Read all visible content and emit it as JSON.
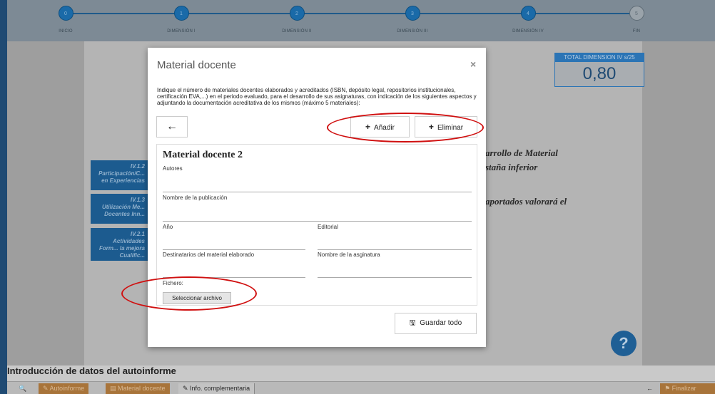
{
  "stepper": {
    "steps": [
      {
        "label": "INICIO",
        "num": "0"
      },
      {
        "label": "DIMENSIÓN I",
        "num": "1"
      },
      {
        "label": "DIMENSIÓN II",
        "num": "2"
      },
      {
        "label": "DIMENSIÓN III",
        "num": "3"
      },
      {
        "label": "DIMENSIÓN IV",
        "num": "4"
      },
      {
        "label": "FIN",
        "num": "5"
      }
    ]
  },
  "total": {
    "label": "TOTAL DIMENSION IV s/25",
    "value": "0,80"
  },
  "background": {
    "side_items": [
      {
        "code": "IV.1.2",
        "lines": "Participación/C... en Experiencias"
      },
      {
        "code": "IV.1.3",
        "lines": "Utilización Me... Docentes Inn..."
      },
      {
        "code": "IV.2.1",
        "lines": "Actividades Form... la mejora Cualific..."
      }
    ],
    "text1": "arrollo de Material",
    "text2": "staña inferior",
    "text3": "aportados valorará el"
  },
  "modal": {
    "title": "Material docente",
    "close": "×",
    "instructions": "Indique el número de materiales docentes elaborados y acreditados (ISBN, depósito legal, repositorios institucionales, certificación EVA,...) en el periodo evaluado, para el desarrollo de sus asignaturas, con indicación de los siguientes aspectos y adjuntando la documentación acreditativa de los mismos (máximo 5 materiales):",
    "back_icon": "←",
    "add_label": "Añadir",
    "remove_label": "Eliminar",
    "plus_icon": "+",
    "form": {
      "title": "Material docente 2",
      "fields": {
        "autores": "Autores",
        "nombre_publicacion": "Nombre de la publicación",
        "anio": "Año",
        "editorial": "Editorial",
        "destinatarios": "Destinatarios del material elaborado",
        "asignatura": "Nombre de la asginatura",
        "fichero": "Fichero:"
      },
      "file_button": "Seleccionar archivo"
    },
    "save_icon": "🖫",
    "save_all": "Guardar todo"
  },
  "help_icon": "?",
  "bottom": {
    "title": "Introducción de datos del autoinforme",
    "toolbar": {
      "zoom_icon": "🔍",
      "autoinforme": "Autoinforme",
      "material_docente": "Material docente",
      "info_complementaria": "Info. complementaria",
      "back_icon": "←",
      "finalizar": "Finalizar"
    }
  }
}
